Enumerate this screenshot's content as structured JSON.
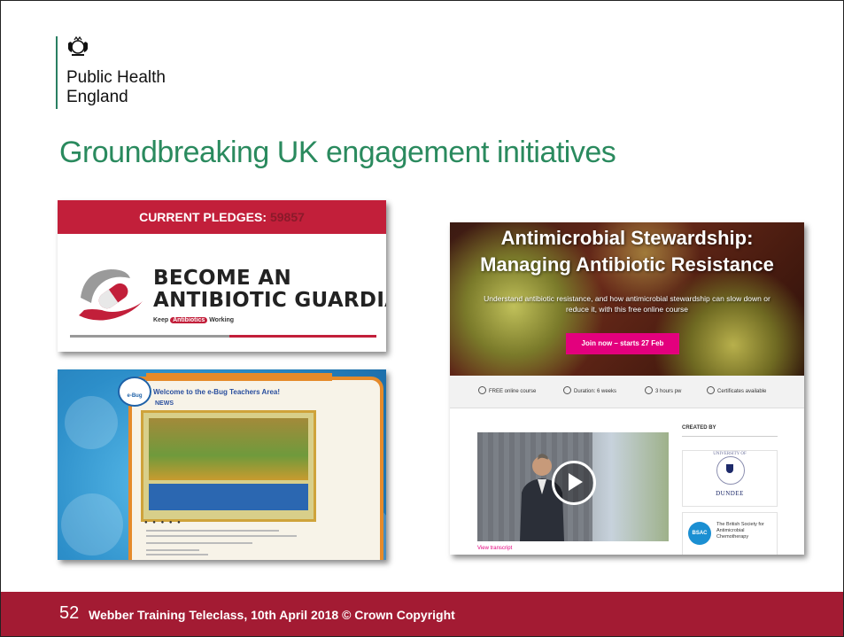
{
  "logo": {
    "org_name_line1": "Public Health",
    "org_name_line2": "England"
  },
  "slide": {
    "title": "Groundbreaking UK engagement initiatives"
  },
  "antibiotic_guardian": {
    "pledges_label": "CURRENT PLEDGES:",
    "pledges_count": "59857",
    "headline_line1": "BECOME AN",
    "headline_line2": "ANTIBIOTIC GUARDIAN",
    "tagline_keep": "Keep",
    "tagline_pill": "Antibiotics",
    "tagline_working": "Working",
    "colors": {
      "accent": "#c21f3a"
    }
  },
  "ebug": {
    "logo_text": "e-Bug",
    "welcome": "Welcome to the e-Bug Teachers Area!",
    "news_heading": "NEWS",
    "carousel_dots": "● ● ● ● ●",
    "colors": {
      "frame": "#e58a2a",
      "background": "#2c8ec9"
    }
  },
  "course": {
    "title_line1": "Antimicrobial Stewardship:",
    "title_line2": "Managing Antibiotic Resistance",
    "subtitle": "Understand antibiotic resistance, and how antimicrobial stewardship can slow down or reduce it, with this free online course",
    "join_button": "Join now – starts 27 Feb",
    "facts": [
      "FREE online course",
      "Duration: 6 weeks",
      "3 hours pw",
      "Certificates available"
    ],
    "view_transcript": "View transcript",
    "created_by": "CREATED BY",
    "org1_univ_of": "UNIVERSITY OF",
    "org1_name": "DUNDEE",
    "org2_logo": "BSAC",
    "org2_name": "The British Society for Antimicrobial Chemotherapy",
    "colors": {
      "accent": "#e3007d"
    }
  },
  "footer": {
    "slide_number": "52",
    "text": "Webber Training Teleclass, 10th April 2018 © Crown Copyright",
    "colors": {
      "background": "#a31b33"
    }
  }
}
